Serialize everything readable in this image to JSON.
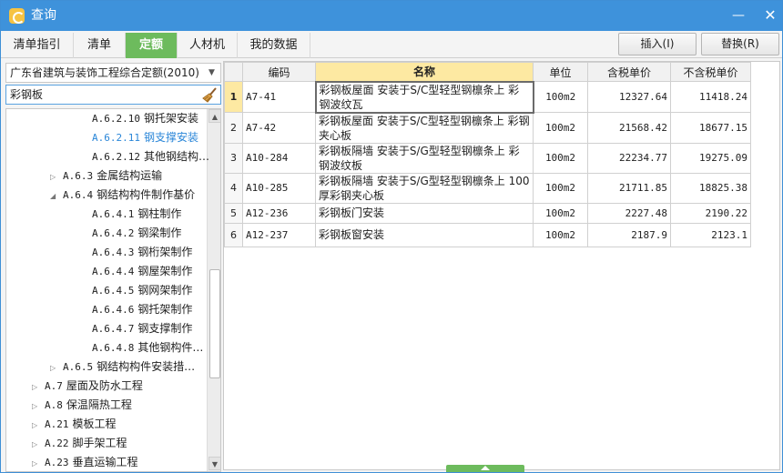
{
  "window": {
    "title": "查询",
    "minimize": "—",
    "close": "✕"
  },
  "tabs": [
    "清单指引",
    "清单",
    "定额",
    "人材机",
    "我的数据"
  ],
  "actions": {
    "insert": "插入(I)",
    "replace": "替换(R)"
  },
  "left": {
    "library": "广东省建筑与装饰工程综合定额(2010)",
    "search_value": "彩钢板",
    "tree": [
      {
        "expander": "",
        "code": "A.6.2.10",
        "label": "钢托架安装",
        "selected": false
      },
      {
        "expander": "",
        "code": "A.6.2.11",
        "label": "钢支撑安装",
        "selected": true
      },
      {
        "expander": "",
        "code": "A.6.2.12",
        "label": "其他钢结构…",
        "selected": false
      },
      {
        "expander": "▷",
        "code": "A.6.3",
        "label": "金属结构运输",
        "selected": false
      },
      {
        "expander": "◢",
        "code": "A.6.4",
        "label": "钢结构构件制作基价",
        "selected": false
      },
      {
        "expander": "",
        "code": "A.6.4.1",
        "label": "钢柱制作",
        "selected": false
      },
      {
        "expander": "",
        "code": "A.6.4.2",
        "label": "钢梁制作",
        "selected": false
      },
      {
        "expander": "",
        "code": "A.6.4.3",
        "label": "钢桁架制作",
        "selected": false
      },
      {
        "expander": "",
        "code": "A.6.4.4",
        "label": "钢屋架制作",
        "selected": false
      },
      {
        "expander": "",
        "code": "A.6.4.5",
        "label": "钢网架制作",
        "selected": false
      },
      {
        "expander": "",
        "code": "A.6.4.6",
        "label": "钢托架制作",
        "selected": false
      },
      {
        "expander": "",
        "code": "A.6.4.7",
        "label": "钢支撑制作",
        "selected": false
      },
      {
        "expander": "",
        "code": "A.6.4.8",
        "label": "其他钢构件…",
        "selected": false
      },
      {
        "expander": "▷",
        "code": "A.6.5",
        "label": "钢结构构件安装措…",
        "selected": false
      },
      {
        "expander": "▷",
        "code": "A.7",
        "label": "屋面及防水工程",
        "selected": false
      },
      {
        "expander": "▷",
        "code": "A.8",
        "label": "保温隔热工程",
        "selected": false
      },
      {
        "expander": "▷",
        "code": "A.21",
        "label": "模板工程",
        "selected": false
      },
      {
        "expander": "▷",
        "code": "A.22",
        "label": "脚手架工程",
        "selected": false
      },
      {
        "expander": "▷",
        "code": "A.23",
        "label": "垂直运输工程",
        "selected": false
      }
    ]
  },
  "grid": {
    "columns": [
      "",
      "编码",
      "名称",
      "单位",
      "含税单价",
      "不含税单价"
    ],
    "rows": [
      {
        "no": "1",
        "code": "A7-41",
        "name": "彩钢板屋面 安装于S/C型轻型钢檩条上 彩钢波纹瓦",
        "unit": "100m2",
        "price_tax": "12327.64",
        "price_notax": "11418.24"
      },
      {
        "no": "2",
        "code": "A7-42",
        "name": "彩钢板屋面 安装于S/C型轻型钢檩条上 彩钢夹心板",
        "unit": "100m2",
        "price_tax": "21568.42",
        "price_notax": "18677.15"
      },
      {
        "no": "3",
        "code": "A10-284",
        "name": "彩钢板隔墙 安装于S/G型轻型钢檩条上 彩钢波纹板",
        "unit": "100m2",
        "price_tax": "22234.77",
        "price_notax": "19275.09"
      },
      {
        "no": "4",
        "code": "A10-285",
        "name": "彩钢板隔墙 安装于S/G型轻型钢檩条上 100厚彩钢夹心板",
        "unit": "100m2",
        "price_tax": "21711.85",
        "price_notax": "18825.38"
      },
      {
        "no": "5",
        "code": "A12-236",
        "name": "彩钢板门安装",
        "unit": "100m2",
        "price_tax": "2227.48",
        "price_notax": "2190.22"
      },
      {
        "no": "6",
        "code": "A12-237",
        "name": "彩钢板窗安装",
        "unit": "100m2",
        "price_tax": "2187.9",
        "price_notax": "2123.1"
      }
    ]
  },
  "colors": {
    "titlebar": "#3e92db",
    "active_tab": "#6dbb5d",
    "header_highlight": "#fde9a2",
    "selected_tree": "#2a86d8"
  }
}
